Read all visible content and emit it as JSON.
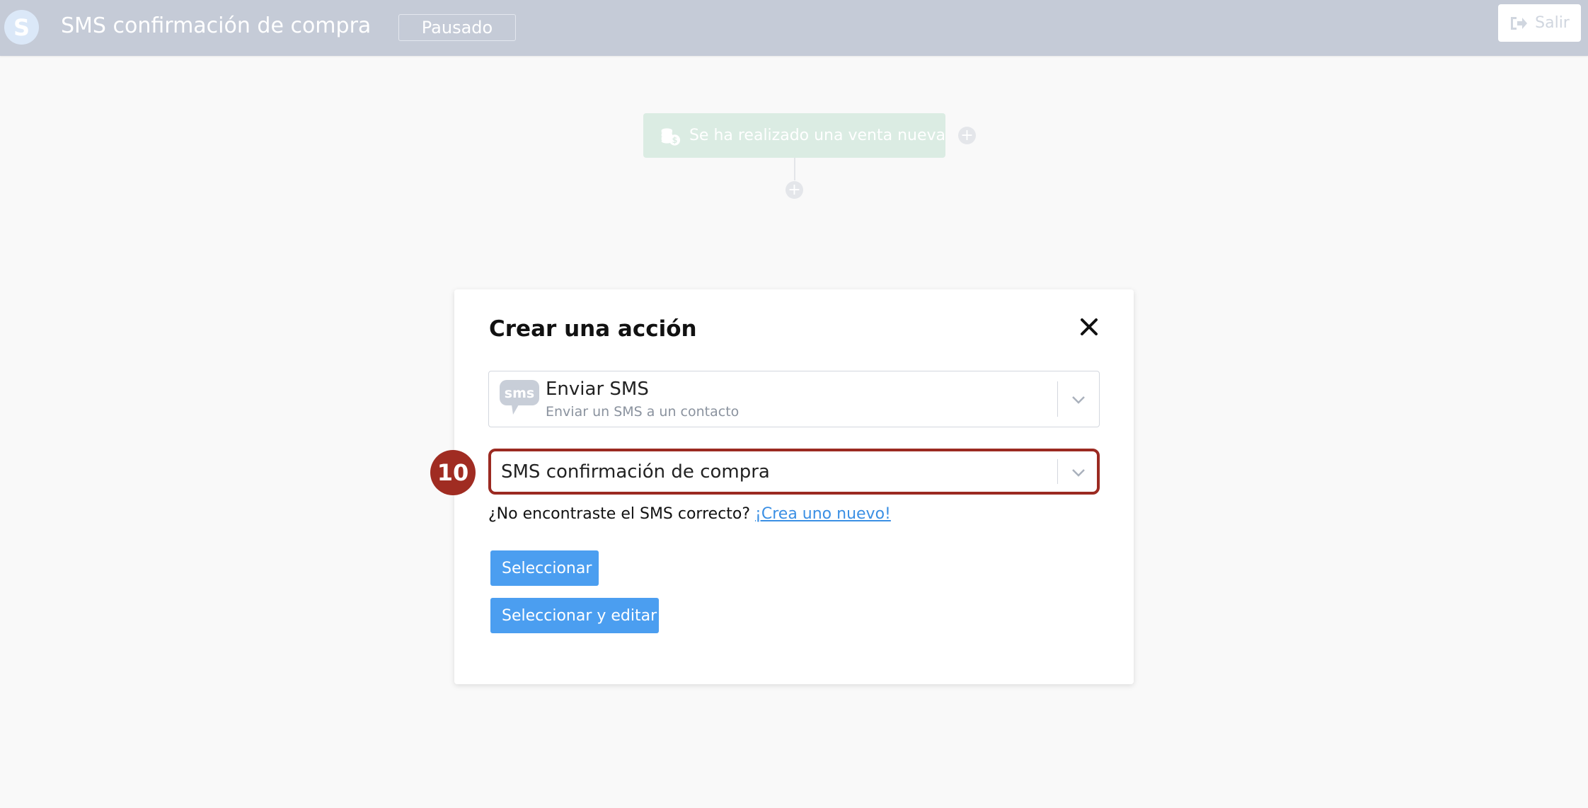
{
  "header": {
    "logo_letter": "S",
    "title": "SMS confirmación de compra",
    "status": "Pausado",
    "exit_label": "Salir"
  },
  "canvas": {
    "trigger_label": "Se ha realizado una venta nueva"
  },
  "modal": {
    "title": "Crear una acción",
    "action_select": {
      "icon_text": "sms",
      "name": "Enviar SMS",
      "description": "Enviar un SMS a un contacto"
    },
    "sms_select": {
      "value": "SMS confirmación de compra"
    },
    "step_number": "10",
    "hint_text": "¿No encontraste el SMS correcto?",
    "hint_link": "¡Crea uno nuevo!",
    "buttons": {
      "select": "Seleccionar",
      "select_edit": "Seleccionar y editar"
    }
  },
  "colors": {
    "topbar": "#c5cbd7",
    "primary_button": "#4b9ef0",
    "highlight": "#9b2a21",
    "link": "#3a8fe4",
    "trigger_node": "#dbece3"
  }
}
